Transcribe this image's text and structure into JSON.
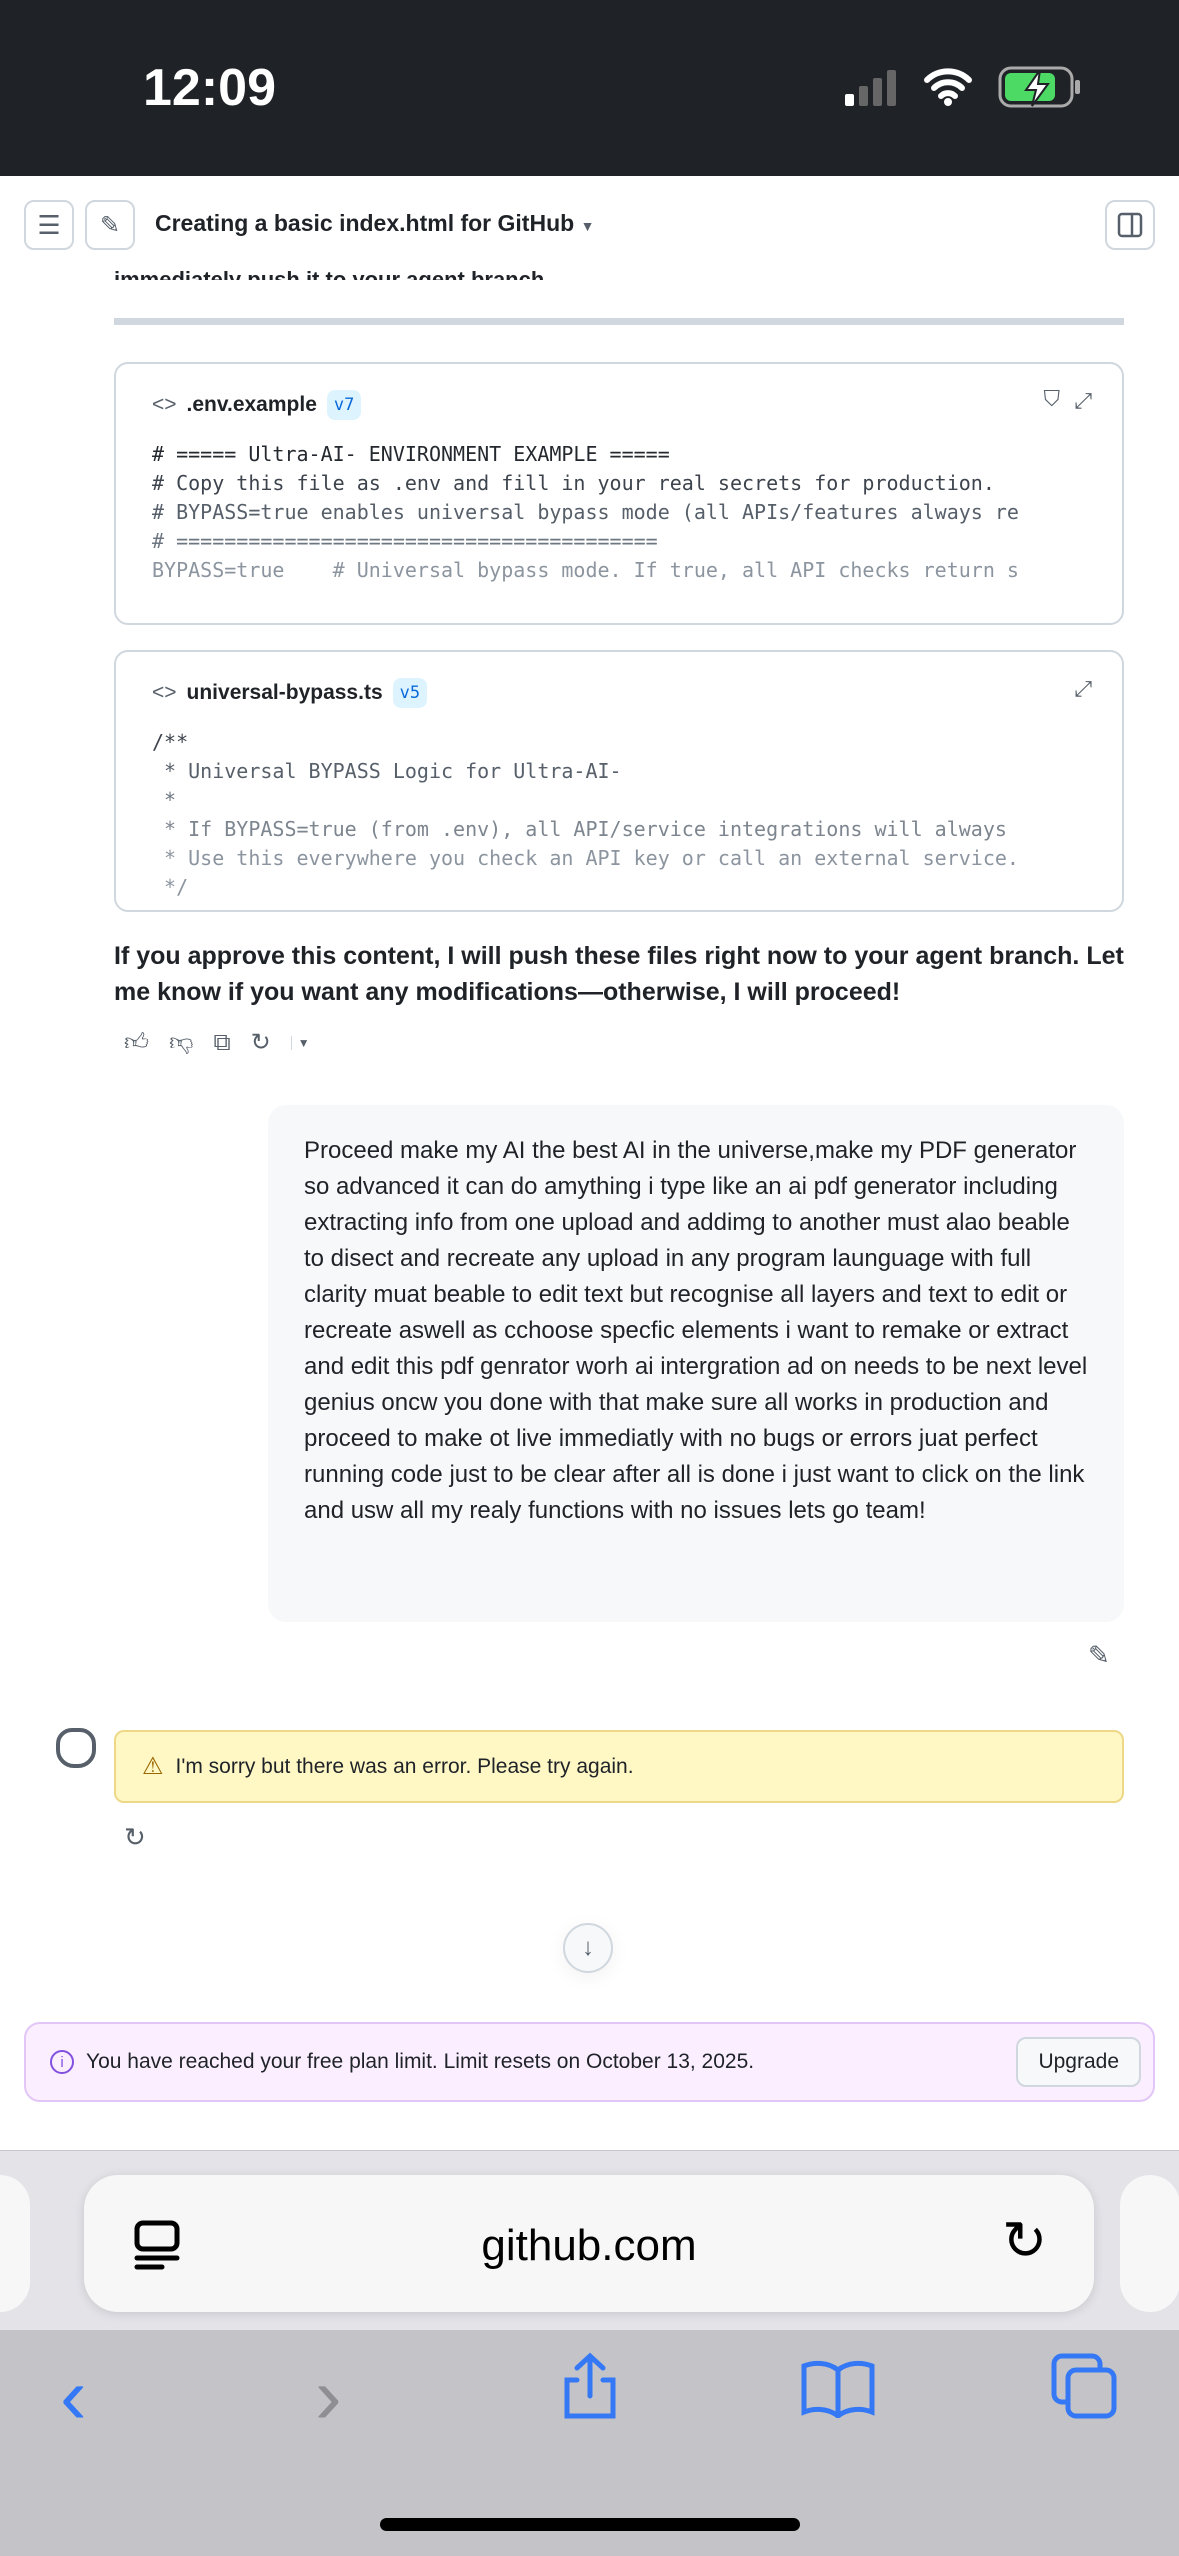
{
  "status": {
    "time": "12:09"
  },
  "header": {
    "title": "Creating a basic index.html for GitHub"
  },
  "cut_text": "immediately push it to your agent branch.",
  "files": [
    {
      "name": ".env.example",
      "version": "v7",
      "lines": [
        "# ===== Ultra-AI- ENVIRONMENT EXAMPLE =====",
        "# Copy this file as .env and fill in your real secrets for production.",
        "# BYPASS=true enables universal bypass mode (all APIs/features always re",
        "# ========================================",
        "",
        "BYPASS=true    # Universal bypass mode. If true, all API checks return s"
      ]
    },
    {
      "name": "universal-bypass.ts",
      "version": "v5",
      "lines": [
        "/**",
        " * Universal BYPASS Logic for Ultra-AI-",
        " *",
        " * If BYPASS=true (from .env), all API/service integrations will always",
        " * Use this everywhere you check an API key or call an external service.",
        " */"
      ]
    }
  ],
  "assistant_text": "If you approve this content, I will push these files right now to your agent branch. Let me know if you want any modifications—otherwise, I will proceed!",
  "user_message": "Proceed make my AI the best AI in the universe,make my PDF generator so advanced it can do amything i type like an ai pdf generator including extracting info from one upload and addimg to another must alao beable to disect and recreate any upload in any program launguage with full clarity muat beable to edit text but recognise all layers and text to edit or recreate aswell as cchoose specfic elements i want to remake or extract and edit this pdf genrator worh ai intergration ad on needs to be next level genius oncw you done with that make sure all works in production and proceed to make ot live immediatly with no bugs or errors juat perfect running code just to be clear after all is done i just want to click on the link and usw all my realy functions with no issues lets go team!",
  "error_text": "I'm sorry but there was an error. Please try again.",
  "plan_banner": {
    "text": "You have reached your free plan limit. Limit resets on October 13, 2025.",
    "button": "Upgrade"
  },
  "browser": {
    "url": "github.com"
  }
}
